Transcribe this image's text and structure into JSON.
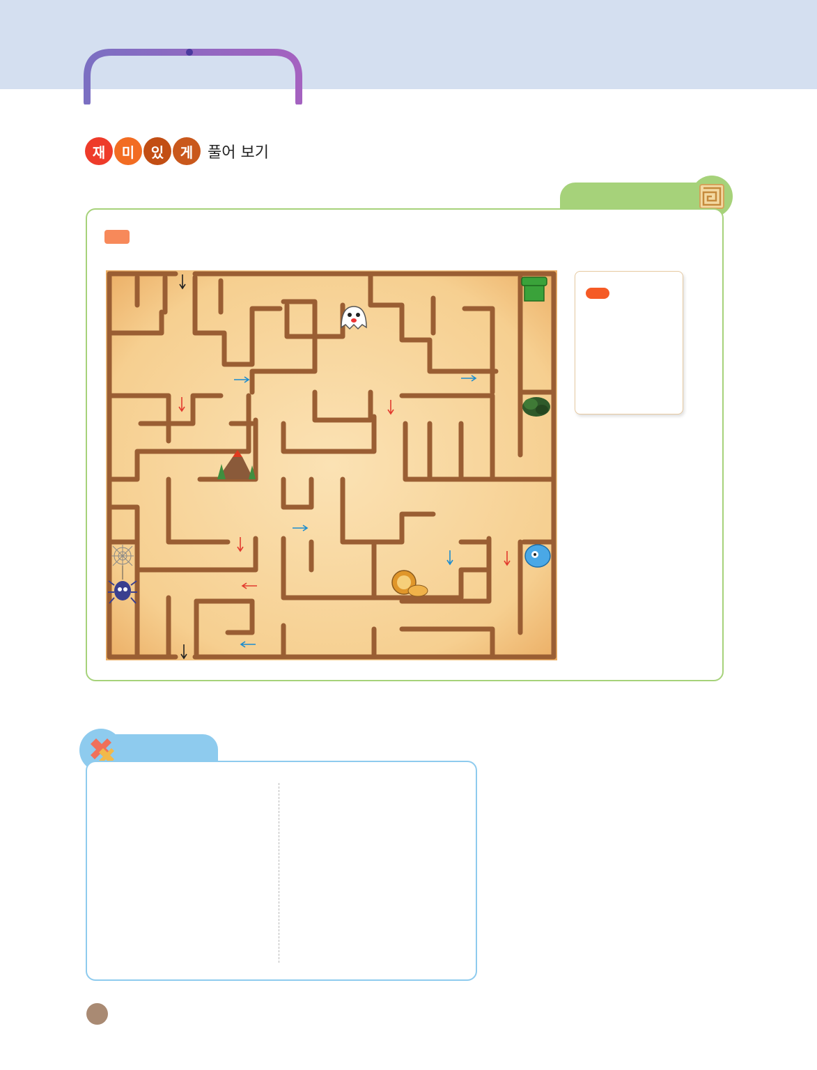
{
  "header": {
    "fun_chars": [
      {
        "text": "재",
        "color": "#ee3b2a"
      },
      {
        "text": "미",
        "color": "#f26c22"
      },
      {
        "text": "있",
        "color": "#c24e14"
      },
      {
        "text": "게",
        "color": "#c9581c"
      }
    ],
    "fun_suffix": "풀어 보기"
  },
  "colors": {
    "band": "#d4dff0",
    "green": "#a6d27a",
    "blue": "#8ecbee",
    "orange": "#f7895a",
    "page_dot": "#a98a73"
  },
  "maze": {
    "characters": [
      "pipe",
      "ghost",
      "bush",
      "volcano",
      "blue-monster",
      "spider-web",
      "spider",
      "lion"
    ],
    "arrow_colors": [
      "black",
      "blue",
      "red"
    ]
  }
}
